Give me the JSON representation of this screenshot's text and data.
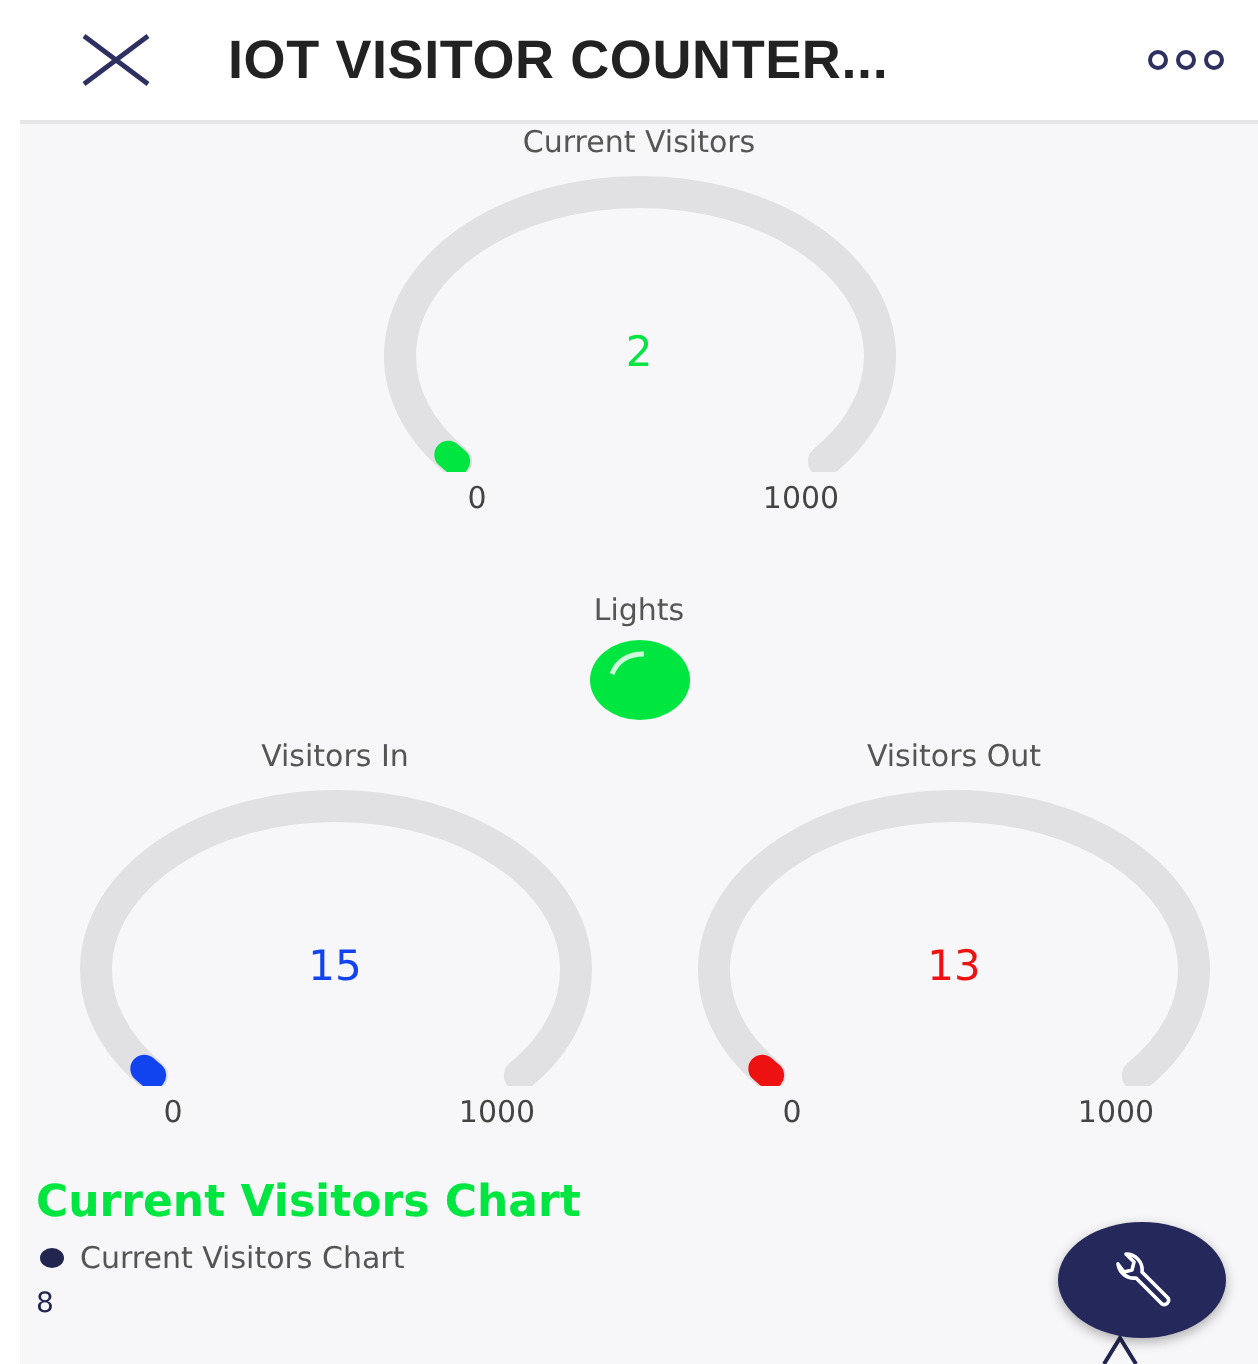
{
  "header": {
    "title": "IOT VISITOR COUNTER..."
  },
  "gauges": [
    {
      "label": "Current Visitors",
      "value": "2",
      "min": "0",
      "max": "1000",
      "color": "#00e640"
    },
    {
      "label": "Visitors In",
      "value": "15",
      "min": "0",
      "max": "1000",
      "color": "#1144ee"
    },
    {
      "label": "Visitors Out",
      "value": "13",
      "min": "0",
      "max": "1000",
      "color": "#ee1111"
    }
  ],
  "light": {
    "label": "Lights",
    "on": true
  },
  "chart": {
    "title": "Current Visitors Chart",
    "legend": "Current Visitors Chart",
    "axis_label": "8"
  }
}
